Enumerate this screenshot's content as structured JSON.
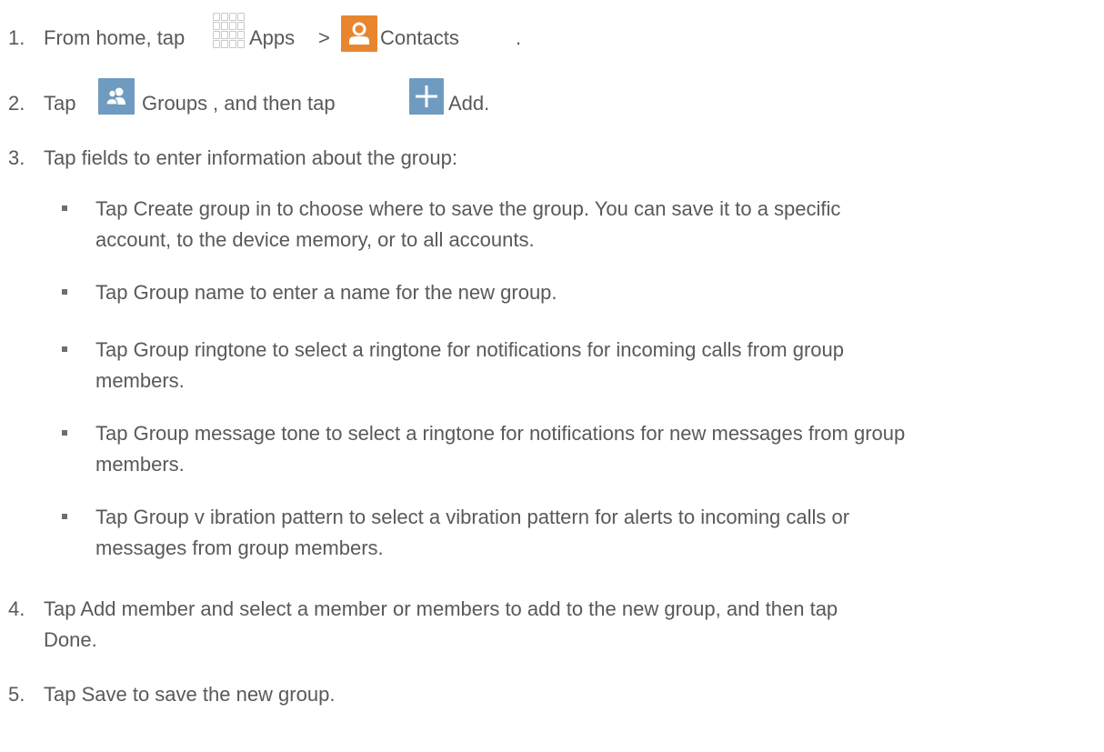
{
  "colors": {
    "text": "#58595b",
    "contacts_tile": "#e8862f",
    "groups_tile": "#6f9bc0",
    "add_tile": "#6f9bc0"
  },
  "icons": {
    "apps": "apps-grid-icon",
    "contacts": "contacts-person-icon",
    "groups": "groups-people-icon",
    "add": "plus-icon"
  },
  "steps": [
    {
      "num": "1.",
      "parts": [
        "From home, tap",
        "Apps",
        ">",
        "Contacts",
        "."
      ]
    },
    {
      "num": "2.",
      "parts": [
        "Tap",
        "Groups",
        ", and then tap",
        "Add."
      ]
    },
    {
      "num": "3.",
      "text": "Tap fields to enter information about the group:"
    },
    {
      "num": "4.",
      "lines": [
        "Tap Add member  and select a member or members to add to the new group, and then tap",
        "Done."
      ]
    },
    {
      "num": "5.",
      "text": "Tap Save to save the new group."
    }
  ],
  "bullets": [
    {
      "lines": [
        "Tap Create group in  to choose where to save the group. You can save it to a specific",
        "account, to the device memory, or to all accounts."
      ]
    },
    {
      "lines": [
        "Tap Group  name  to enter a name for the new group."
      ]
    },
    {
      "lines": [
        "Tap Group ringtone   to select a ringtone for notifications for incoming calls from group",
        "members."
      ]
    },
    {
      "lines": [
        "Tap Group message tone   to select a ringtone for notifications for new messages from group",
        "members."
      ]
    },
    {
      "lines": [
        "Tap Group v ibration pattern   to select a vibration pattern for alerts to incoming calls or",
        "messages from group members."
      ]
    }
  ]
}
